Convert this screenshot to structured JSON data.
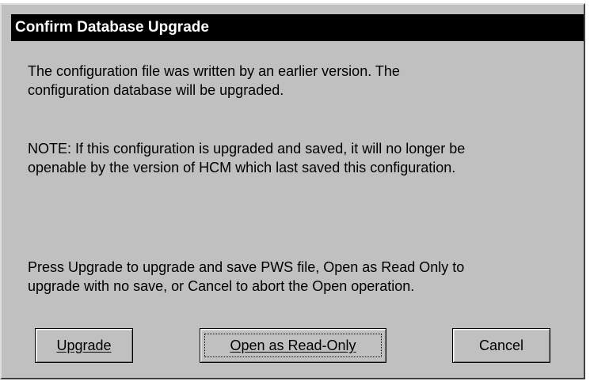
{
  "window": {
    "title": "Confirm Database Upgrade"
  },
  "message": {
    "para1": [
      "The configuration file was written by an earlier version. The",
      "configuration database will be upgraded."
    ],
    "para2": [
      "NOTE: If this configuration is upgraded and saved, it will no longer be",
      "openable by the version of HCM which last saved this configuration."
    ],
    "para3": [
      "Press Upgrade to upgrade and save PWS file, Open as Read Only to",
      "upgrade with no save, or Cancel to abort the Open operation."
    ]
  },
  "buttons": {
    "upgrade": "Upgrade",
    "open_read_only": "Open as Read-Only",
    "cancel": "Cancel"
  },
  "colors": {
    "titlebar": "#000000",
    "dialog_bg": "#c0c0c0"
  }
}
